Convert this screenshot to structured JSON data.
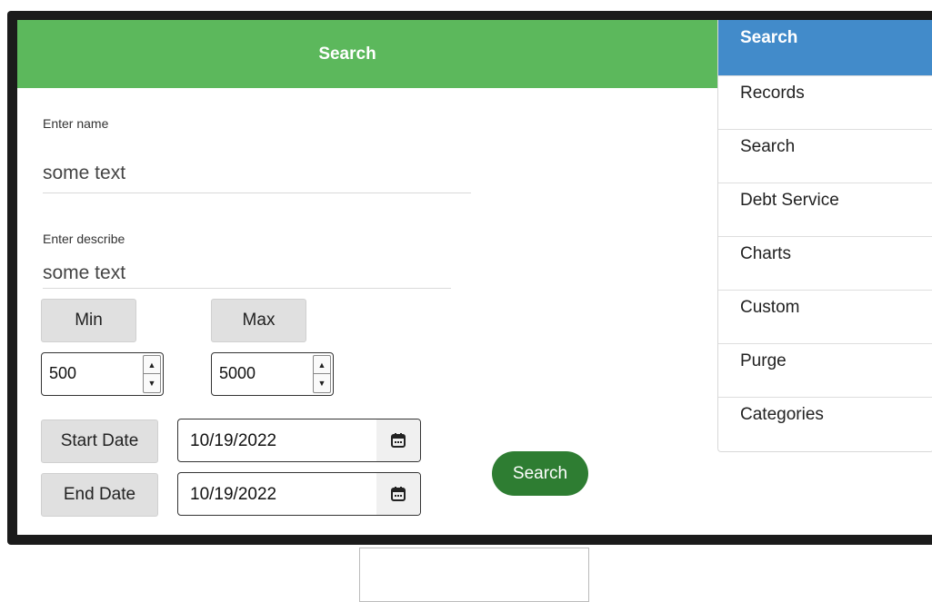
{
  "header": {
    "title": "Search"
  },
  "form": {
    "name": {
      "label": "Enter name",
      "value": "some text"
    },
    "describe": {
      "label": "Enter describe",
      "value": "some text"
    },
    "min": {
      "label": "Min",
      "value": "500"
    },
    "max": {
      "label": "Max",
      "value": "5000"
    },
    "start_date": {
      "label": "Start Date",
      "value": "10/19/2022"
    },
    "end_date": {
      "label": "End Date",
      "value": "10/19/2022"
    },
    "submit_label": "Search"
  },
  "sidebar": {
    "items": [
      {
        "label": "Search",
        "active": true
      },
      {
        "label": "Records"
      },
      {
        "label": "Search"
      },
      {
        "label": "Debt Service"
      },
      {
        "label": "Charts"
      },
      {
        "label": "Custom"
      },
      {
        "label": "Purge"
      },
      {
        "label": "Categories"
      }
    ]
  },
  "colors": {
    "header_bg": "#5cb85c",
    "active_nav_bg": "#428bca",
    "search_button_bg": "#2e7d32"
  },
  "icons": {
    "calendar": "calendar-icon",
    "spin_up": "spin-up-icon",
    "spin_down": "spin-down-icon"
  }
}
